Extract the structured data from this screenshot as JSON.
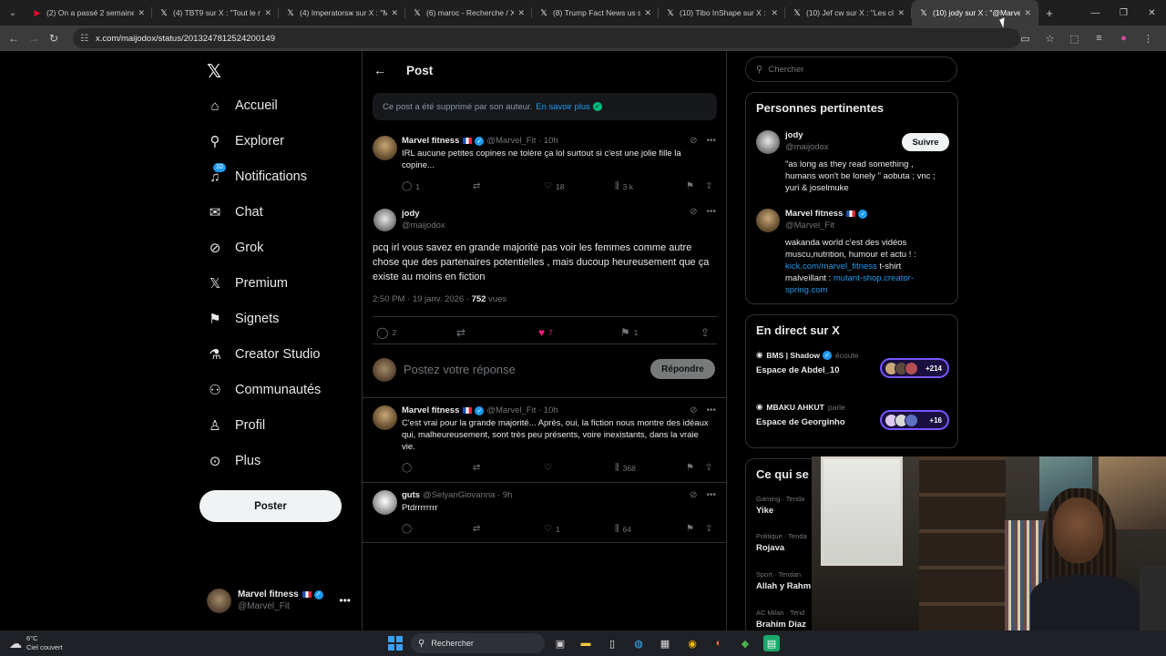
{
  "browser": {
    "tabs": [
      {
        "title": "(2) On a passé 2 semaines",
        "active": false
      },
      {
        "title": "(4) TBT9 sur X : \"Tout le m",
        "active": false
      },
      {
        "title": "(4) Imperatorsж sur X : \"M",
        "active": false
      },
      {
        "title": "(6) maroc - Recherche / X",
        "active": false
      },
      {
        "title": "(8) Trump Fact News us sur",
        "active": false
      },
      {
        "title": "(10) Tibo InShape sur X :",
        "active": false
      },
      {
        "title": "(10) Jef cw sur X : \"Les cli",
        "active": false
      },
      {
        "title": "(10) jody sur X : \"@Marve",
        "active": true
      }
    ],
    "url": "x.com/maijodox/status/2013247812524200149"
  },
  "nav": {
    "items": [
      {
        "label": "Accueil",
        "icon": "home-icon"
      },
      {
        "label": "Explorer",
        "icon": "search-icon"
      },
      {
        "label": "Notifications",
        "icon": "bell-icon",
        "badge": "10"
      },
      {
        "label": "Chat",
        "icon": "mail-icon"
      },
      {
        "label": "Grok",
        "icon": "grok-icon"
      },
      {
        "label": "Premium",
        "icon": "x-premium-icon"
      },
      {
        "label": "Signets",
        "icon": "bookmark-icon"
      },
      {
        "label": "Creator Studio",
        "icon": "flask-icon"
      },
      {
        "label": "Communautés",
        "icon": "communities-icon"
      },
      {
        "label": "Profil",
        "icon": "person-icon"
      },
      {
        "label": "Plus",
        "icon": "more-circle-icon"
      }
    ],
    "post_button": "Poster",
    "account": {
      "name": "Marvel fitness",
      "handle": "@Marvel_Fit"
    }
  },
  "center": {
    "title": "Post",
    "deleted_notice": "Ce post a été supprimé par son auteur.",
    "deleted_link": "En savoir plus",
    "parent_tweet": {
      "name": "Marvel fitness",
      "meta": "@Marvel_Fit · 10h",
      "text": "IRL aucune petites copines ne tolère ça lol surtout si c'est une jolie fille la copine...",
      "replies": "1",
      "retweets": "",
      "likes": "18",
      "views": "3 k"
    },
    "main_tweet": {
      "name": "jody",
      "handle": "@maijodox",
      "text": "pcq irl vous savez en grande majorité pas voir les femmes comme autre chose que des partenaires potentielles , mais ducoup heureusement que ça existe au moins en fiction",
      "timestamp": "2:50 PM · 19 janv. 2026 ·",
      "views_count": "752",
      "views_label": "vues",
      "replies": "2",
      "likes": "7",
      "bookmarks": "1"
    },
    "reply_box": {
      "placeholder": "Postez votre réponse",
      "button": "Répondre"
    },
    "replies": [
      {
        "name": "Marvel fitness",
        "meta": "@Marvel_Fit · 10h",
        "text": "C'est vrai pour la grande majorité... Après, oui, la fiction nous montre des idéaux qui, malheureusement, sont très peu présents, voire inexistants, dans la vraie vie.",
        "replies": "",
        "likes": "",
        "views": "368"
      },
      {
        "name": "guts",
        "meta": "@SelyanGiovanna · 9h",
        "text": "Ptdrrrrrrrr",
        "replies": "",
        "likes": "1",
        "views": "64"
      }
    ]
  },
  "right": {
    "search_placeholder": "Chercher",
    "people_title": "Personnes pertinentes",
    "people": [
      {
        "name": "jody",
        "handle": "@maijodox",
        "bio": "\"as long as they read something , humans won't be lonely \" aobuta ; vnc ; yuri & joselmuke",
        "follow": "Suivre"
      },
      {
        "name": "Marvel fitness",
        "handle": "@Marvel_Fit",
        "bio_pre": "wakanda world c'est des vidéos muscu,nutrition, humour et actu ! :",
        "link1": "kick.com/marvel_fitness",
        "bio_mid": " t-shirt malveillant : ",
        "link2": "mutant-shop.creator-spring.com"
      }
    ],
    "live_title": "En direct sur X",
    "spaces": [
      {
        "host": "BMS | Shadow",
        "action": "écoute",
        "title": "Espace de Abdel_10",
        "count": "+214"
      },
      {
        "host": "MBAKU AHKUT",
        "action": "parle",
        "title": "Espace de Georginho",
        "count": "+16"
      }
    ],
    "trends_title": "Ce qui se",
    "trends": [
      {
        "category": "Gaming · Tenda",
        "name": "Yike"
      },
      {
        "category": "Politique · Tenda",
        "name": "Rojava"
      },
      {
        "category": "Sport · Tendan",
        "name": "Allah y Rahm"
      },
      {
        "category": "AC Milan · Tend",
        "name": "Brahim Diaz"
      }
    ]
  },
  "taskbar": {
    "temp": "6°C",
    "weather": "Ciel couvert",
    "search": "Rechercher"
  }
}
